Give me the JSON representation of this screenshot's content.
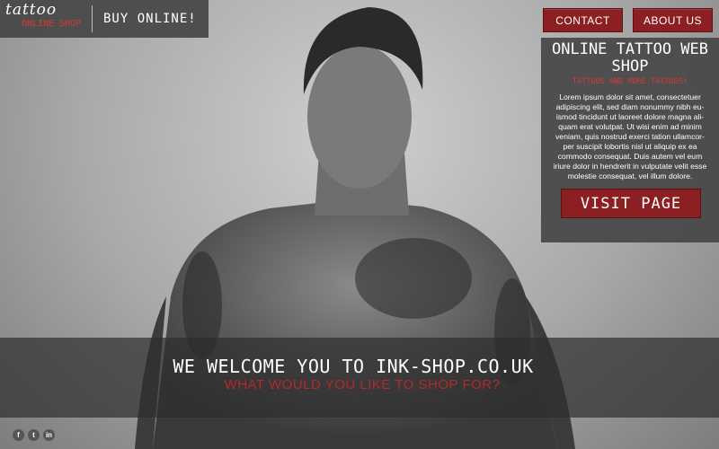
{
  "header": {
    "logo_script": "tattoo",
    "logo_sub": "ONLINE SHOP",
    "tagline": "BUY ONLINE!"
  },
  "nav": {
    "contact_label": "CONTACT",
    "about_label": "ABOUT US"
  },
  "panel": {
    "title": "ONLINE TATTOO WEB SHOP",
    "subtitle": "TATTOOS AND MORE TATTOOS!",
    "body": "Lorem ipsum dolor sit amet, consectetuer adipiscing elit, sed diam nonummy nibh eu-ismod tincidunt ut laoreet dolore magna ali-quam erat volutpat. Ut wisi enim ad minim veniam, quis nostrud exerci tation ullamcor-per suscipit lobortis nisl ut aliquip ex ea commodo consequat. Duis autem vel eum iriure dolor in hendrerit in vulputate velit esse molestie consequat, vel illum dolore.",
    "visit_label": "VISIT PAGE"
  },
  "banner": {
    "title": "WE WELCOME YOU TO INK-SHOP.CO.UK",
    "subtitle": "WHAT WOULD YOU LIKE TO SHOP FOR?"
  },
  "social": [
    {
      "icon": "facebook-icon",
      "glyph": "f"
    },
    {
      "icon": "twitter-icon",
      "glyph": "t"
    },
    {
      "icon": "linkedin-icon",
      "glyph": "in"
    }
  ],
  "colors": {
    "accent_red": "#8c1f22",
    "panel_gray": "#464646",
    "subtitle_red": "#d23a3a"
  }
}
